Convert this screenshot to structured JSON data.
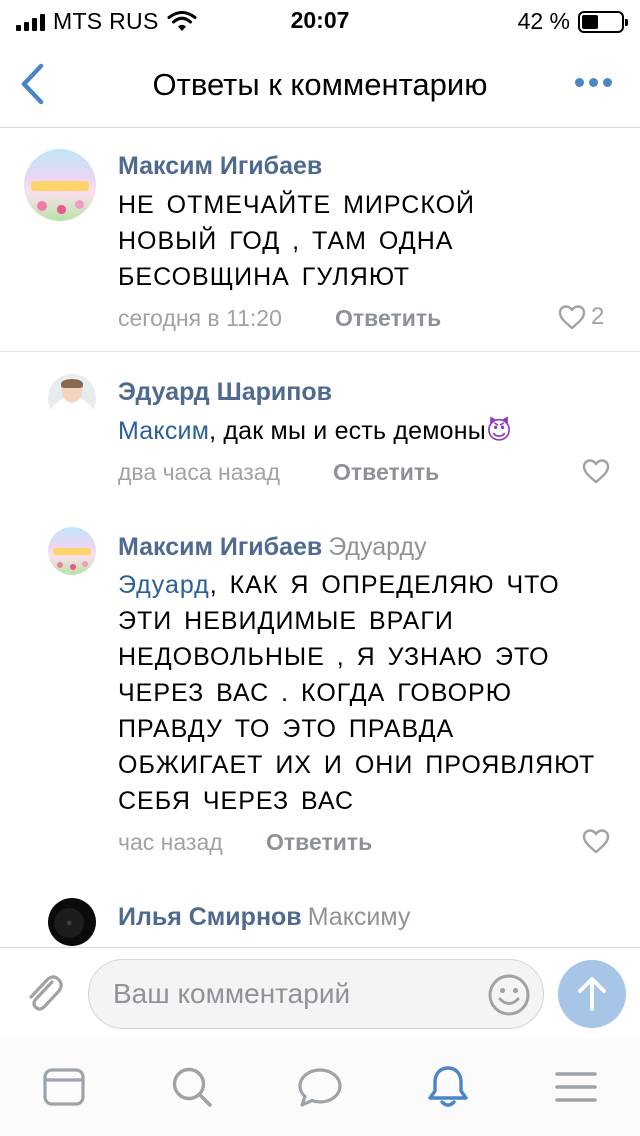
{
  "status_bar": {
    "carrier": "MTS RUS",
    "time": "20:07",
    "battery_text": "42 %",
    "battery_level": 0.42
  },
  "nav": {
    "title": "Ответы к комментарию",
    "back_icon": "chevron-left-icon",
    "more_icon": "more-dots-icon"
  },
  "comments": [
    {
      "author": "Максим Игибаев",
      "reply_to": "",
      "mention": "",
      "text": "НЕ ОТМЕЧАЙТЕ МИРСКОЙ НОВЫЙ ГОД , ТАМ ОДНА БЕСОВЩИНА ГУЛЯЮТ",
      "time": "сегодня в 11:20",
      "reply_label": "Ответить",
      "likes": "2"
    },
    {
      "author": "Эдуард Шарипов",
      "reply_to": "",
      "mention": "Максим",
      "text": ", дак мы и есть демоны",
      "emoji": "😈",
      "time": "два часа назад",
      "reply_label": "Ответить",
      "likes": ""
    },
    {
      "author": "Максим Игибаев",
      "reply_to": "Эдуарду",
      "mention": "Эдуард",
      "text": ", КАК Я ОПРЕДЕЛЯЮ ЧТО ЭТИ НЕВИДИМЫЕ ВРАГИ НЕДОВОЛЬНЫЕ , Я УЗНАЮ ЭТО ЧЕРЕЗ ВАС . КОГДА ГОВОРЮ ПРАВДУ ТО ЭТО ПРАВДА ОБЖИГАЕТ ИХ И ОНИ ПРОЯВЛЯЮТ СЕБЯ ЧЕРЕЗ ВАС",
      "time": "час назад",
      "reply_label": "Ответить",
      "likes": ""
    },
    {
      "author": "Илья Смирнов",
      "reply_to": "Максиму",
      "mention": "",
      "text": "",
      "time": "",
      "reply_label": "",
      "likes": ""
    }
  ],
  "composer": {
    "placeholder": "Ваш комментарий",
    "attach_icon": "paperclip-icon",
    "emoji_icon": "smile-icon",
    "send_icon": "send-arrow-icon"
  },
  "tabs": [
    {
      "icon": "news-icon"
    },
    {
      "icon": "search-icon"
    },
    {
      "icon": "messages-icon"
    },
    {
      "icon": "notifications-bell-icon",
      "active": true
    },
    {
      "icon": "menu-icon"
    }
  ],
  "colors": {
    "accent": "#4a86c5",
    "name": "#4f6a8f",
    "mention": "#2a5f98",
    "secondary": "#9ea3a8",
    "send_button": "#a7c5e6"
  }
}
